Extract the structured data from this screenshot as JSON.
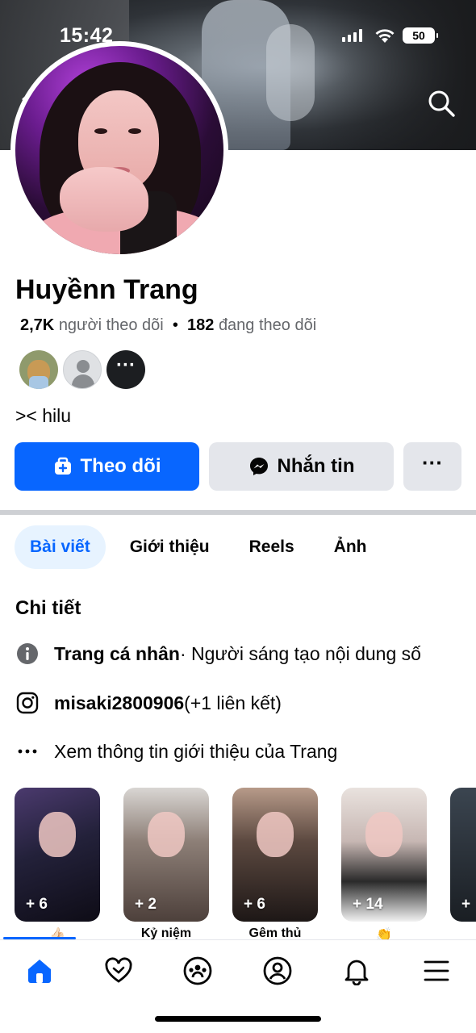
{
  "status_bar": {
    "time": "15:42",
    "battery": "50"
  },
  "profile": {
    "name": "Huyềnn Trang",
    "followers_count": "2,7K",
    "followers_label": "người theo dõi",
    "separator": "•",
    "following_count": "182",
    "following_label": "đang theo dõi",
    "bio": ">< hilu",
    "mutual_more": "···"
  },
  "actions": {
    "follow_label": "Theo dõi",
    "message_label": "Nhắn tin",
    "more_label": "···"
  },
  "tabs": [
    {
      "label": "Bài viết",
      "active": true
    },
    {
      "label": "Giới thiệu",
      "active": false
    },
    {
      "label": "Reels",
      "active": false
    },
    {
      "label": "Ảnh",
      "active": false
    }
  ],
  "details": {
    "title": "Chi tiết",
    "page_type_bold": "Trang cá nhân",
    "page_type_rest": " · Người sáng tạo nội dung số",
    "instagram_handle": "misaki2800906",
    "instagram_extra": " (+1 liên kết)",
    "see_about": "Xem thông tin giới thiệu của Trang"
  },
  "highlights": [
    {
      "count": "+ 6",
      "label": "👍🏻"
    },
    {
      "count": "+ 2",
      "label": "Kỷ niệm"
    },
    {
      "count": "+ 6",
      "label": "Gêm thủ"
    },
    {
      "count": "+ 14",
      "label": "👏"
    },
    {
      "count": "+",
      "label": ""
    }
  ],
  "icons": {
    "back": "chevron-left-icon",
    "search": "search-icon",
    "follow": "add-friend-icon",
    "message": "messenger-icon",
    "info": "info-icon",
    "instagram": "instagram-icon",
    "more": "more-dots-icon"
  },
  "colors": {
    "primary": "#0866ff",
    "secondary_button": "#e4e6eb",
    "active_tab_bg": "#e7f3ff",
    "muted_text": "#65676b"
  }
}
